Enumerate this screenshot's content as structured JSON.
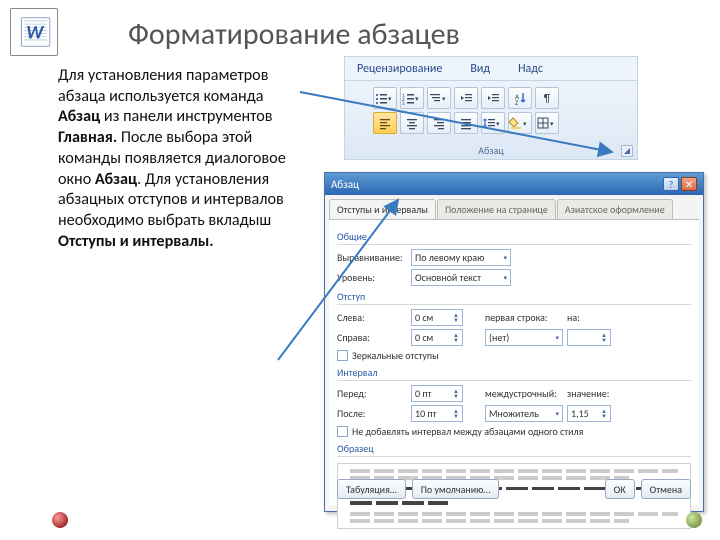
{
  "title": "Форматирование абзацев",
  "body": {
    "t1": "Для установления параметров абзаца используется команда ",
    "b1": "Абзац",
    "t2": " из панели инструментов ",
    "b2": "Главная.",
    "t3": " После выбора этой команды появляется диалоговое окно ",
    "b3": "Абзац",
    "t4": ". Для установления абзацных отступов и интервалов необходимо выбрать вкладыш ",
    "b4": "Отступы и интервалы."
  },
  "ribbon": {
    "tabs": [
      "Рецензирование",
      "Вид",
      "Надс"
    ],
    "group_label": "Абзац"
  },
  "dialog": {
    "title": "Абзац",
    "tabs": [
      "Отступы и интервалы",
      "Положение на странице",
      "Азиатское оформление"
    ],
    "section_general": "Общие",
    "align_label": "Выравнивание:",
    "align_value": "По левому краю",
    "level_label": "Уровень:",
    "level_value": "Основной текст",
    "section_indent": "Отступ",
    "left_label": "Слева:",
    "left_value": "0 см",
    "right_label": "Справа:",
    "right_value": "0 см",
    "first_label": "первая строка:",
    "first_value": "(нет)",
    "by_label": "на:",
    "by_value": "",
    "mirror": "Зеркальные отступы",
    "section_spacing": "Интервал",
    "before_label": "Перед:",
    "before_value": "0 пт",
    "after_label": "После:",
    "after_value": "10 пт",
    "line_label": "междустрочный:",
    "line_value": "Множитель",
    "lineval_label": "значение:",
    "lineval_value": "1,15",
    "nospace": "Не добавлять интервал между абзацами одного стиля",
    "section_preview": "Образец",
    "btn_tabs": "Табуляция…",
    "btn_default": "По умолчанию…",
    "btn_ok": "ОК",
    "btn_cancel": "Отмена"
  }
}
